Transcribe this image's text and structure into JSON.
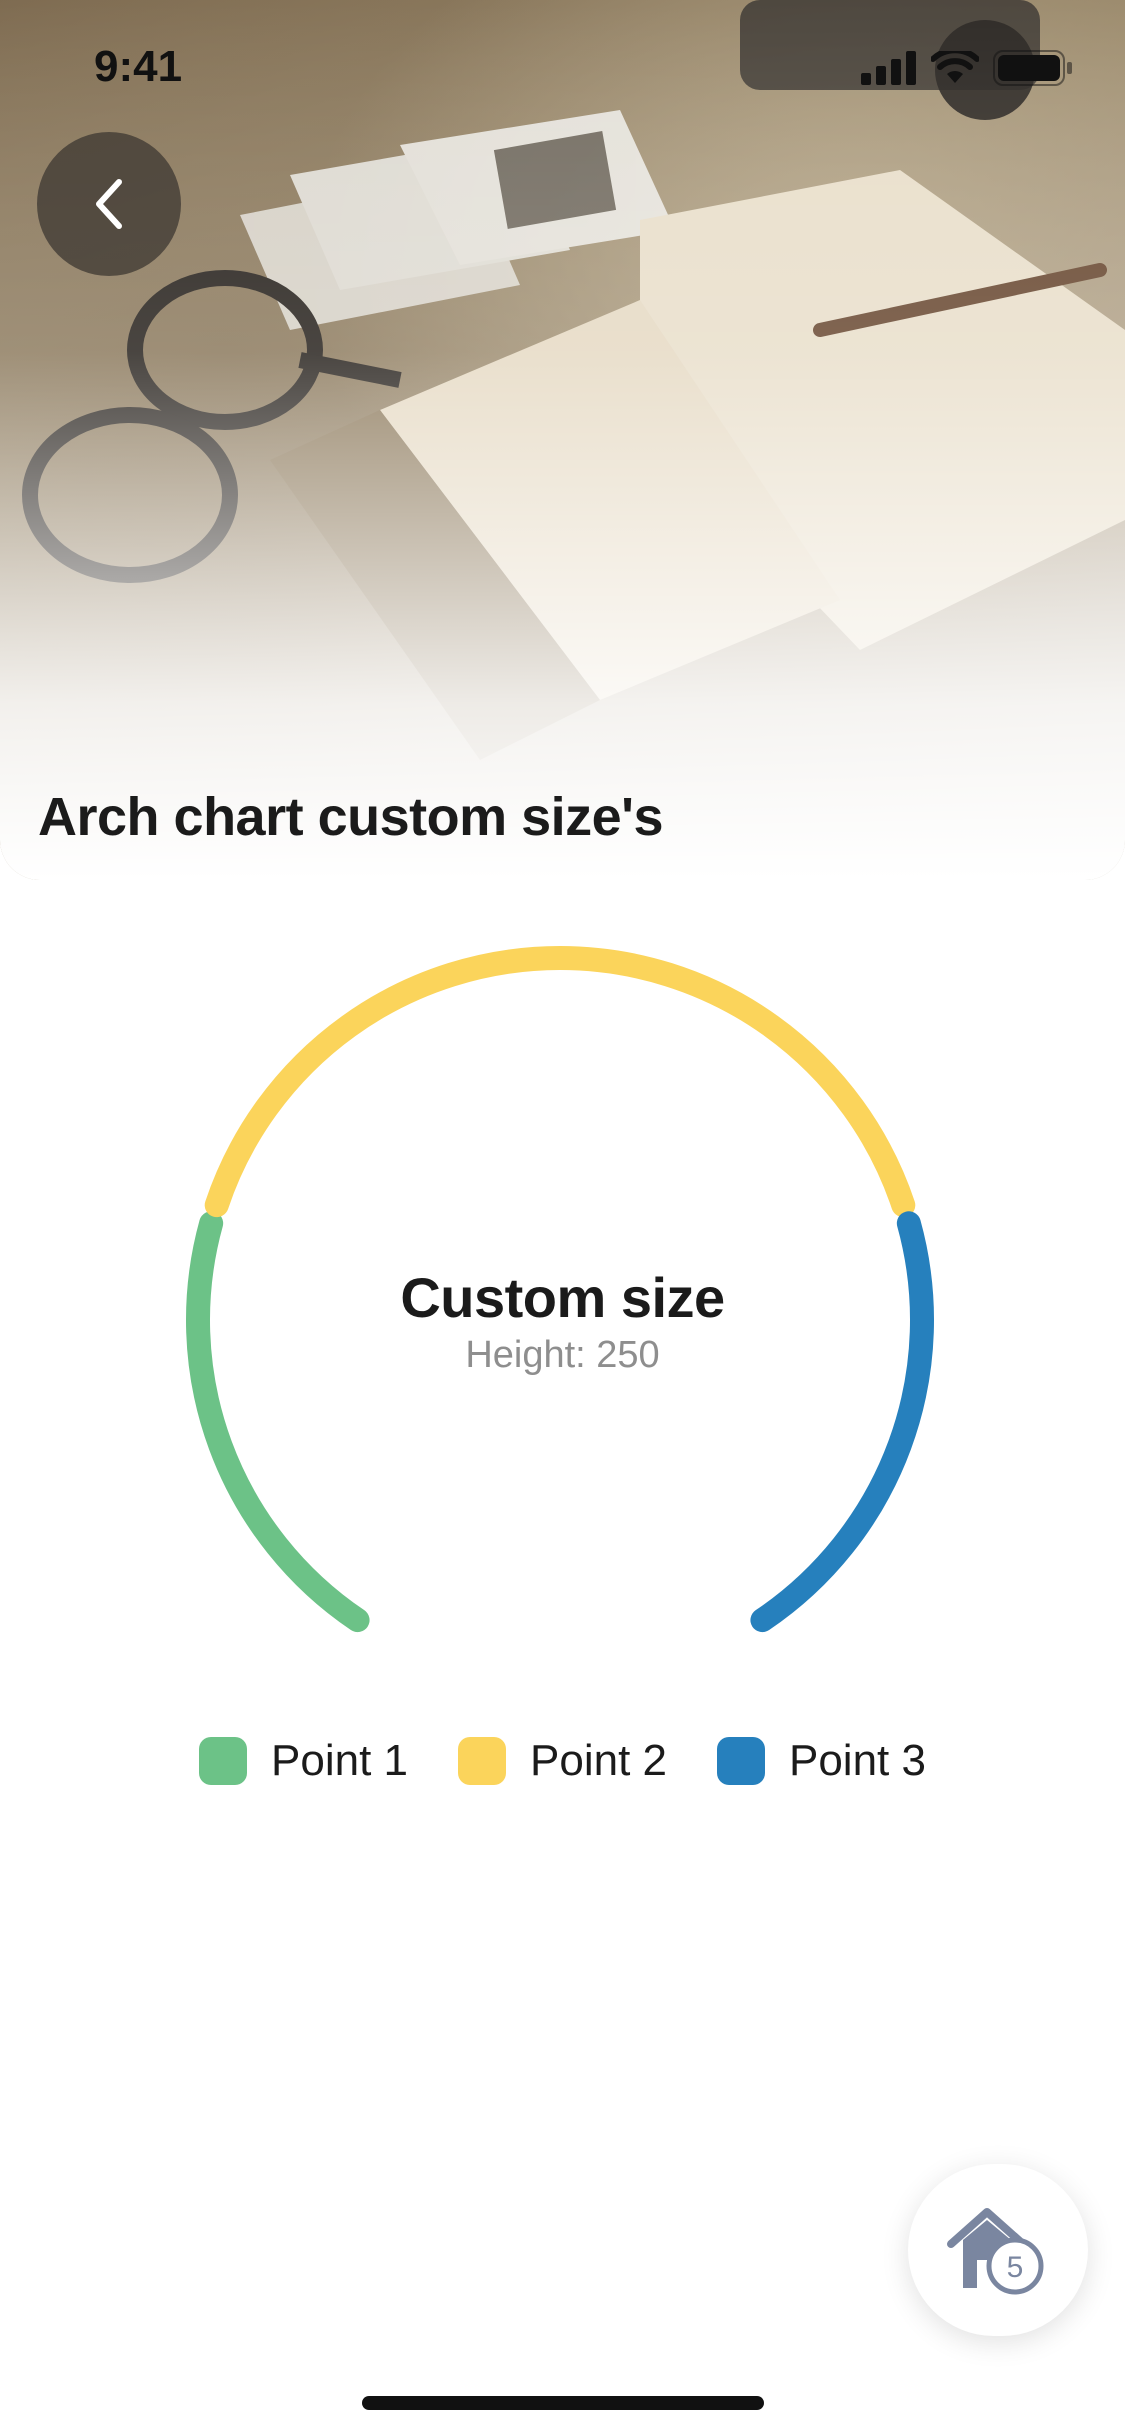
{
  "status_bar": {
    "time": "9:41"
  },
  "header": {
    "title": "Arch chart custom size's"
  },
  "chart": {
    "title": "Custom size",
    "subtitle": "Height: 250"
  },
  "chart_data": {
    "type": "arch",
    "title": "Custom size",
    "subtitle": "Height: 250",
    "series": [
      {
        "name": "Point 1",
        "value": 1,
        "color": "#6cc287"
      },
      {
        "name": "Point 2",
        "value": 2,
        "color": "#fbd45b"
      },
      {
        "name": "Point 3",
        "value": 1,
        "color": "#2680bd"
      }
    ],
    "legend": "bottom"
  },
  "legend": {
    "items": [
      {
        "label": "Point 1",
        "color": "#6cc287"
      },
      {
        "label": "Point 2",
        "color": "#fbd45b"
      },
      {
        "label": "Point 3",
        "color": "#2680bd"
      }
    ]
  },
  "fab": {
    "icon": "home-icon",
    "badge": "5"
  },
  "icons": {
    "back": "chevron-left-icon",
    "signal": "cellular-signal-icon",
    "wifi": "wifi-icon",
    "battery": "battery-icon"
  }
}
